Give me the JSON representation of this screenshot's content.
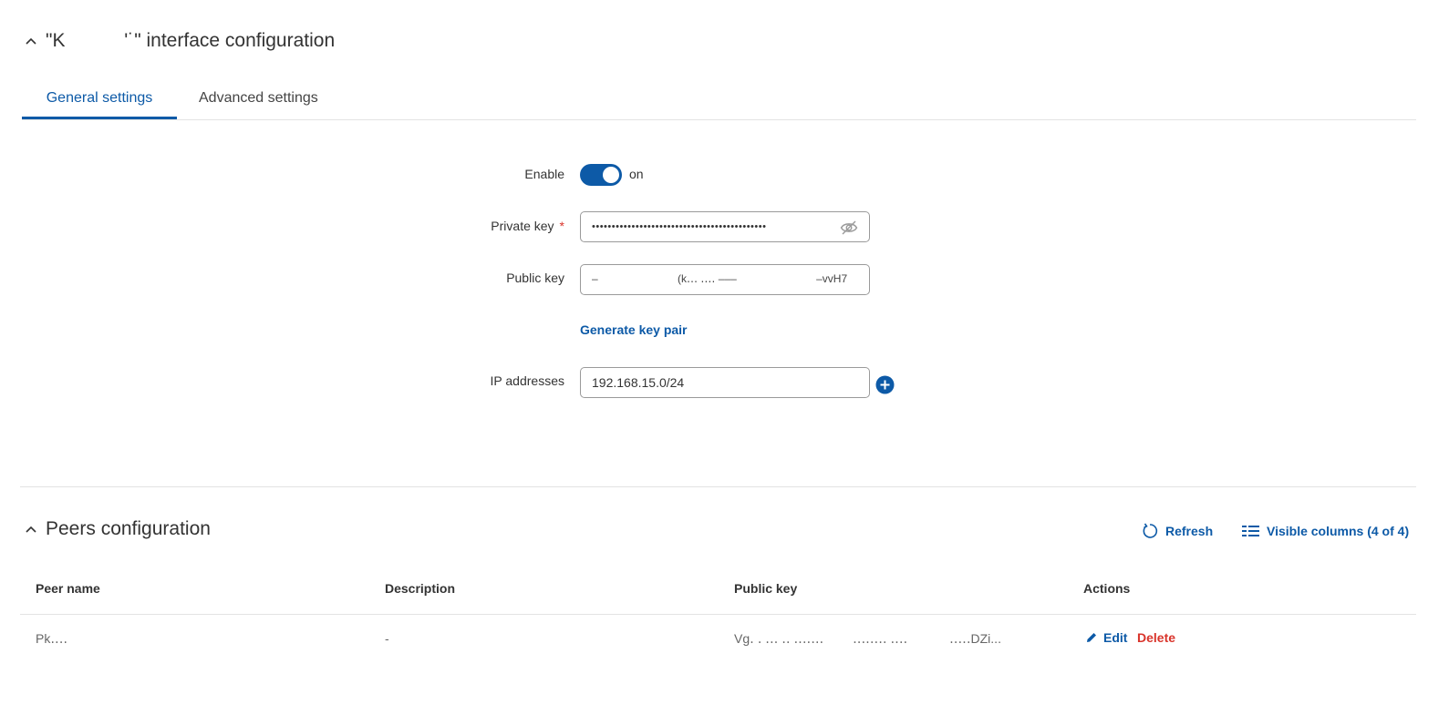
{
  "interface_section": {
    "title": "\"K    '˙\" interface configuration",
    "collapse_icon": "chevron-up-icon"
  },
  "tabs": [
    {
      "label": "General settings",
      "active": true
    },
    {
      "label": "Advanced settings",
      "active": false
    }
  ],
  "form": {
    "enable": {
      "label": "Enable",
      "state_text": "on",
      "checked": true
    },
    "private_key": {
      "label": "Private key",
      "required_marker": "*",
      "value": "••••••••••••••••••••••••••••••••••••••••••••",
      "icon": "eye-slash-icon"
    },
    "public_key": {
      "label": "Public key",
      "value": "‒        (k․․․ ․․․․ ‒‒–        ‒vvH7"
    },
    "generate_link": "Generate key pair",
    "ip_addresses": {
      "label": "IP addresses",
      "value": "192.168.15.0/24",
      "add_icon": "plus-circle-icon"
    }
  },
  "peers_section": {
    "title": "Peers configuration",
    "collapse_icon": "chevron-up-icon",
    "refresh_label": "Refresh",
    "visible_columns_label": "Visible columns (4 of 4)"
  },
  "table": {
    "columns": [
      "Peer name",
      "Description",
      "Public key",
      "Actions"
    ],
    "rows": [
      {
        "peer_name": "Pk․․․․",
        "description": "-",
        "public_key": "Vg․ ․ ․․․ ․․ ․․․․․․․   ․․․․․․․․ ․․․․    ․․․․․DZi...",
        "edit_label": "Edit",
        "delete_label": "Delete"
      }
    ]
  },
  "colors": {
    "accent": "#0d5aa7",
    "danger": "#d9342b",
    "border": "#e3e3e3"
  }
}
